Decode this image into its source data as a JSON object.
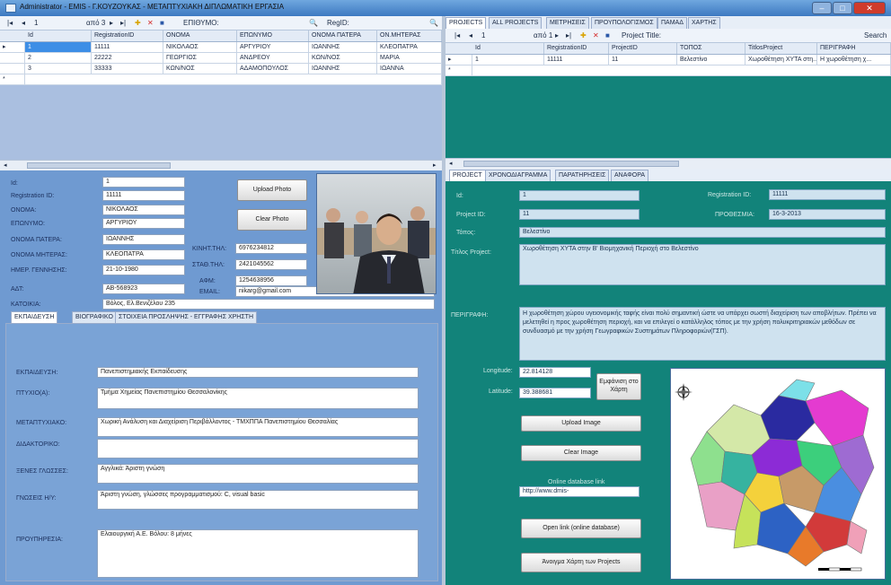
{
  "window": {
    "title": "Administrator - EMIS - Γ.ΚΟΥΖΟΥΚΑΣ - ΜΕΤΑΠΤΥΧΙΑΚΗ ΔΙΠΛΩΜΑΤΙΚΗ ΕΡΓΑΣΙΑ",
    "min": "–",
    "max": "□",
    "close": "✕"
  },
  "left_toolbar": {
    "first": "|◂",
    "prev": "◂",
    "position": "1",
    "of": "από 3",
    "next": "▸",
    "last": "▸|",
    "search_label": "ΕΠΙΘΥΜΟ:",
    "regid_label": "RegID:"
  },
  "left_grid": {
    "columns": [
      "Id",
      "RegistrationID",
      "ΟΝΟΜΑ",
      "ΕΠΩΝΥΜΟ",
      "ΟΝΟΜΑ ΠΑΤΕΡΑ",
      "ΟΝ.ΜΗΤΕΡΑΣ"
    ],
    "rows": [
      [
        "1",
        "11111",
        "ΝΙΚΟΛΑΟΣ",
        "ΑΡΓΥΡΙΟΥ",
        "ΙΩΑΝΝΗΣ",
        "ΚΛΕΟΠΑΤΡΑ"
      ],
      [
        "2",
        "22222",
        "ΓΕΩΡΓΙΟΣ",
        "ΑΝΔΡΕΟΥ",
        "ΚΩΝ/ΝΟΣ",
        "ΜΑΡΙΑ"
      ],
      [
        "3",
        "33333",
        "ΚΩΝ/ΝΟΣ",
        "ΑΔΑΜΟΠΟΥΛΟΣ",
        "ΙΩΑΝΝΗΣ",
        "ΙΩΑΝΝΑ"
      ]
    ],
    "new_row_marker": "*"
  },
  "person": {
    "labels": {
      "id": "Id:",
      "regid": "Registration ID:",
      "name": "ΟΝΟΜΑ:",
      "surname": "ΕΠΩΝΥΜΟ:",
      "father": "ΟΝΟΜΑ ΠΑΤΕΡΑ:",
      "mother": "ΟΝΟΜΑ ΜΗΤΕΡΑΣ:",
      "birth": "ΗΜΕΡ. ΓΕΝΝΗΣΗΣ:",
      "adt": "ΑΔΤ:",
      "address": "ΚΑΤΟΙΚΙΑ:",
      "mobile": "ΚΙΝΗΤ.ΤΗΛ:",
      "phone": "ΣΤΑΘ.ΤΗΛ:",
      "afm": "ΑΦΜ:",
      "email": "EMAIL:"
    },
    "values": {
      "id": "1",
      "regid": "11111",
      "name": "ΝΙΚΟΛΑΟΣ",
      "surname": "ΑΡΓΥΡΙΟΥ",
      "father": "ΙΩΑΝΝΗΣ",
      "mother": "ΚΛΕΟΠΑΤΡΑ",
      "birth": "21-10-1980",
      "adt": "ΑΒ-568923",
      "address": "Βόλος, Ελ.Βενιζέλου 235",
      "mobile": "6976234812",
      "phone": "2421045562",
      "afm": "1254638956",
      "email": "nikarg@gmail.com"
    },
    "upload_photo": "Upload Photo",
    "clear_photo": "Clear Photo"
  },
  "left_tabs": [
    "ΕΚΠΑΙΔΕΥΣΗ",
    "ΒΙΟΓΡΑΦΙΚΟ",
    "ΣΤΟΙΧΕΙΑ ΠΡΟΣΛΗΨΗΣ - ΕΓΓΡΑΦΗΣ ΧΡΗΣΤΗ"
  ],
  "education": {
    "labels": {
      "ekp": "ΕΚΠΑΙΔΕΥΣΗ:",
      "ptyxio": "ΠΤΥΧΙΟ(Α):",
      "metapt": "ΜΕΤΑΠΤΥΧΙΑΚΟ:",
      "didakt": "ΔΙΔΑΚΤΟΡΙΚΟ:",
      "xenes": "ΞΕΝΕΣ ΓΛΩΣΣΕΣ:",
      "gnoseis": "ΓΝΩΣΕΙΣ Η/Υ:",
      "proyp": "ΠΡΟΥΠΗΡΕΣΙΑ:"
    },
    "values": {
      "ekp": "Πανεπιστημιακής Εκπαίδευσης",
      "ptyxio": "Τμήμα Χημείας Πανεπιστημίου Θεσσαλονίκης",
      "metapt": "Χωρική Ανάλυση και Διαχείριση Περιβάλλοντος - ΤΜΧΠΠΑ Πανεπιστημίου Θεσσαλίας",
      "didakt": "",
      "xenes": "Αγγλικά: Άριστη γνώση",
      "gnoseis": "Άριστη γνώση, γλώσσες προγραμματισμού: C, visual basic",
      "proyp": "Ελαιουργική Α.Ε. Βόλου: 8 μήνες"
    }
  },
  "right_tabs": [
    "PROJECTS",
    "ALL PROJECTS",
    "ΜΕΤΡΗΣΕΙΣ",
    "ΠΡΟΥΠΟΛΟΓΙΣΜΟΣ",
    "ΠΑΜΑΔ",
    "ΧΑΡΤΗΣ"
  ],
  "right_toolbar": {
    "first": "|◂",
    "prev": "◂",
    "position": "1",
    "of": "από 1",
    "next": "▸",
    "last": "▸|",
    "title_label": "Project Title:",
    "search": "Search"
  },
  "right_grid": {
    "columns": [
      "Id",
      "RegistrationID",
      "ProjectID",
      "ΤΟΠΟΣ",
      "TitlosProject",
      "ΠΕΡΙΓΡΑΦΗ"
    ],
    "rows": [
      [
        "1",
        "11111",
        "11",
        "Βελεστίνο",
        "Χωροθέτηση ΧΥΤΑ στη...",
        "Η χωροθέτηση χ..."
      ]
    ],
    "new_row_marker": "*"
  },
  "project_tabs": [
    "PROJECT",
    "ΧΡΟΝΟΔΙΑΓΡΑΜΜΑ",
    "ΠΑΡΑΤΗΡΗΣΕΙΣ",
    "ΑΝΑΦΟΡΑ"
  ],
  "project": {
    "labels": {
      "id": "Id:",
      "projectid": "Project ID:",
      "topos": "Τόπος:",
      "titlos": "Τίτλος Project:",
      "perigrafi": "ΠΕΡΙΓΡΑΦΗ:",
      "regid": "Registration ID:",
      "prothesmia": "ΠΡΟΘΕΣΜΙΑ:",
      "longitude": "Longitude:",
      "latitude": "Latitude:",
      "link": "Online database link"
    },
    "values": {
      "id": "1",
      "projectid": "11",
      "topos": "Βελεστίνο",
      "titlos": "Χωροθέτηση ΧΥΤΑ στην Β' Βιομηχανική Περιοχή στο Βελεστίνο",
      "perigrafi": "Η χωροθέτηση χώρου υγειονομικής ταφής είναι πολύ σημαντική ώστε να υπάρχει σωστή διαχείριση των αποβλήτων. Πρέπει να μελετηθεί η προς χωροθέτηση περιοχή, και να επιλεγεί ο κατάλληλος τόπος με την χρήση πολυκριτηριακών μεθόδων σε συνδυασμό με την χρήση Γεωγραφικών Συστημάτων Πληροφοριών(ΓΣΠ).",
      "regid": "11111",
      "prothesmia": "16-3-2013",
      "longitude": "22.814128",
      "latitude": "39.388681",
      "link": "http://www.dmis-"
    },
    "show_map": "Εμφάνιση στο Χάρτη",
    "upload_image": "Upload Image",
    "clear_image": "Clear Image",
    "open_link": "Open link (online database)",
    "open_map": "Άνοιγμα Χάρτη των Projects"
  },
  "colors": {
    "accent": "#3d8ee6",
    "teal": "#12837a",
    "blue_panel": "#6f9ad1"
  }
}
